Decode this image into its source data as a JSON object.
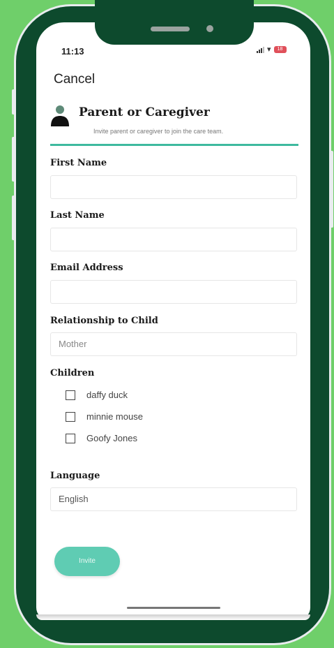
{
  "status_bar": {
    "time": "11:13",
    "battery": "18"
  },
  "nav": {
    "cancel_label": "Cancel"
  },
  "header": {
    "title": "Parent or Caregiver",
    "subtitle": "Invite parent or caregiver to join the care team.",
    "icon": "person-icon",
    "accent_color": "#3EB99E"
  },
  "form": {
    "first_name": {
      "label": "First Name",
      "value": ""
    },
    "last_name": {
      "label": "Last Name",
      "value": ""
    },
    "email": {
      "label": "Email Address",
      "value": ""
    },
    "relationship": {
      "label": "Relationship to Child",
      "placeholder": "Mother"
    },
    "children": {
      "label": "Children",
      "items": [
        {
          "label": "daffy duck",
          "checked": false
        },
        {
          "label": "minnie mouse",
          "checked": false
        },
        {
          "label": "Goofy Jones",
          "checked": false
        }
      ]
    },
    "language": {
      "label": "Language",
      "value": "English"
    }
  },
  "invite_button": {
    "label": "Invite",
    "color": "#5FCCB3"
  },
  "colors": {
    "background": "#6FCF6A",
    "device": "#0D4A2D"
  }
}
